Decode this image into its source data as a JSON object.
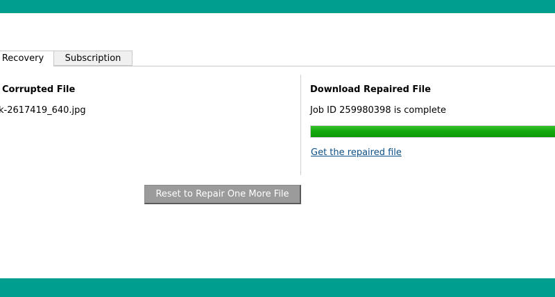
{
  "theme": {
    "brand_color": "#009e8f",
    "progress_color": "#15a80f",
    "link_color": "#0b4f86",
    "button_color": "#9b9b9b"
  },
  "tabs": [
    {
      "label": "Recovery",
      "active": true
    },
    {
      "label": "Subscription",
      "active": false
    }
  ],
  "left_panel": {
    "heading": "Corrupted File",
    "filename": "k-2617419_640.jpg"
  },
  "right_panel": {
    "heading": "Download Repaired File",
    "job_status": "Job ID 259980398 is complete",
    "progress_fraction": 1.0,
    "download_link": "Get the repaired file"
  },
  "reset_button_label": "Reset to Repair One More File"
}
